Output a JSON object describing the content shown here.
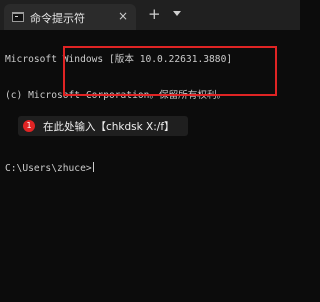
{
  "tab": {
    "title": "命令提示符",
    "close_label": "×",
    "icon": "terminal-icon"
  },
  "toolbar": {
    "new_tab_label": "+",
    "dropdown_icon": "chevron-down-icon"
  },
  "console": {
    "lines": [
      "Microsoft Windows [版本 10.0.22631.3880]",
      "(c) Microsoft Corporation。保留所有权利。"
    ],
    "prompt": "C:\\Users\\zhuce>"
  },
  "annotation": {
    "badge": "1",
    "text": "在此处输入【chkdsk X:/f】",
    "highlight_color": "#e02424"
  }
}
